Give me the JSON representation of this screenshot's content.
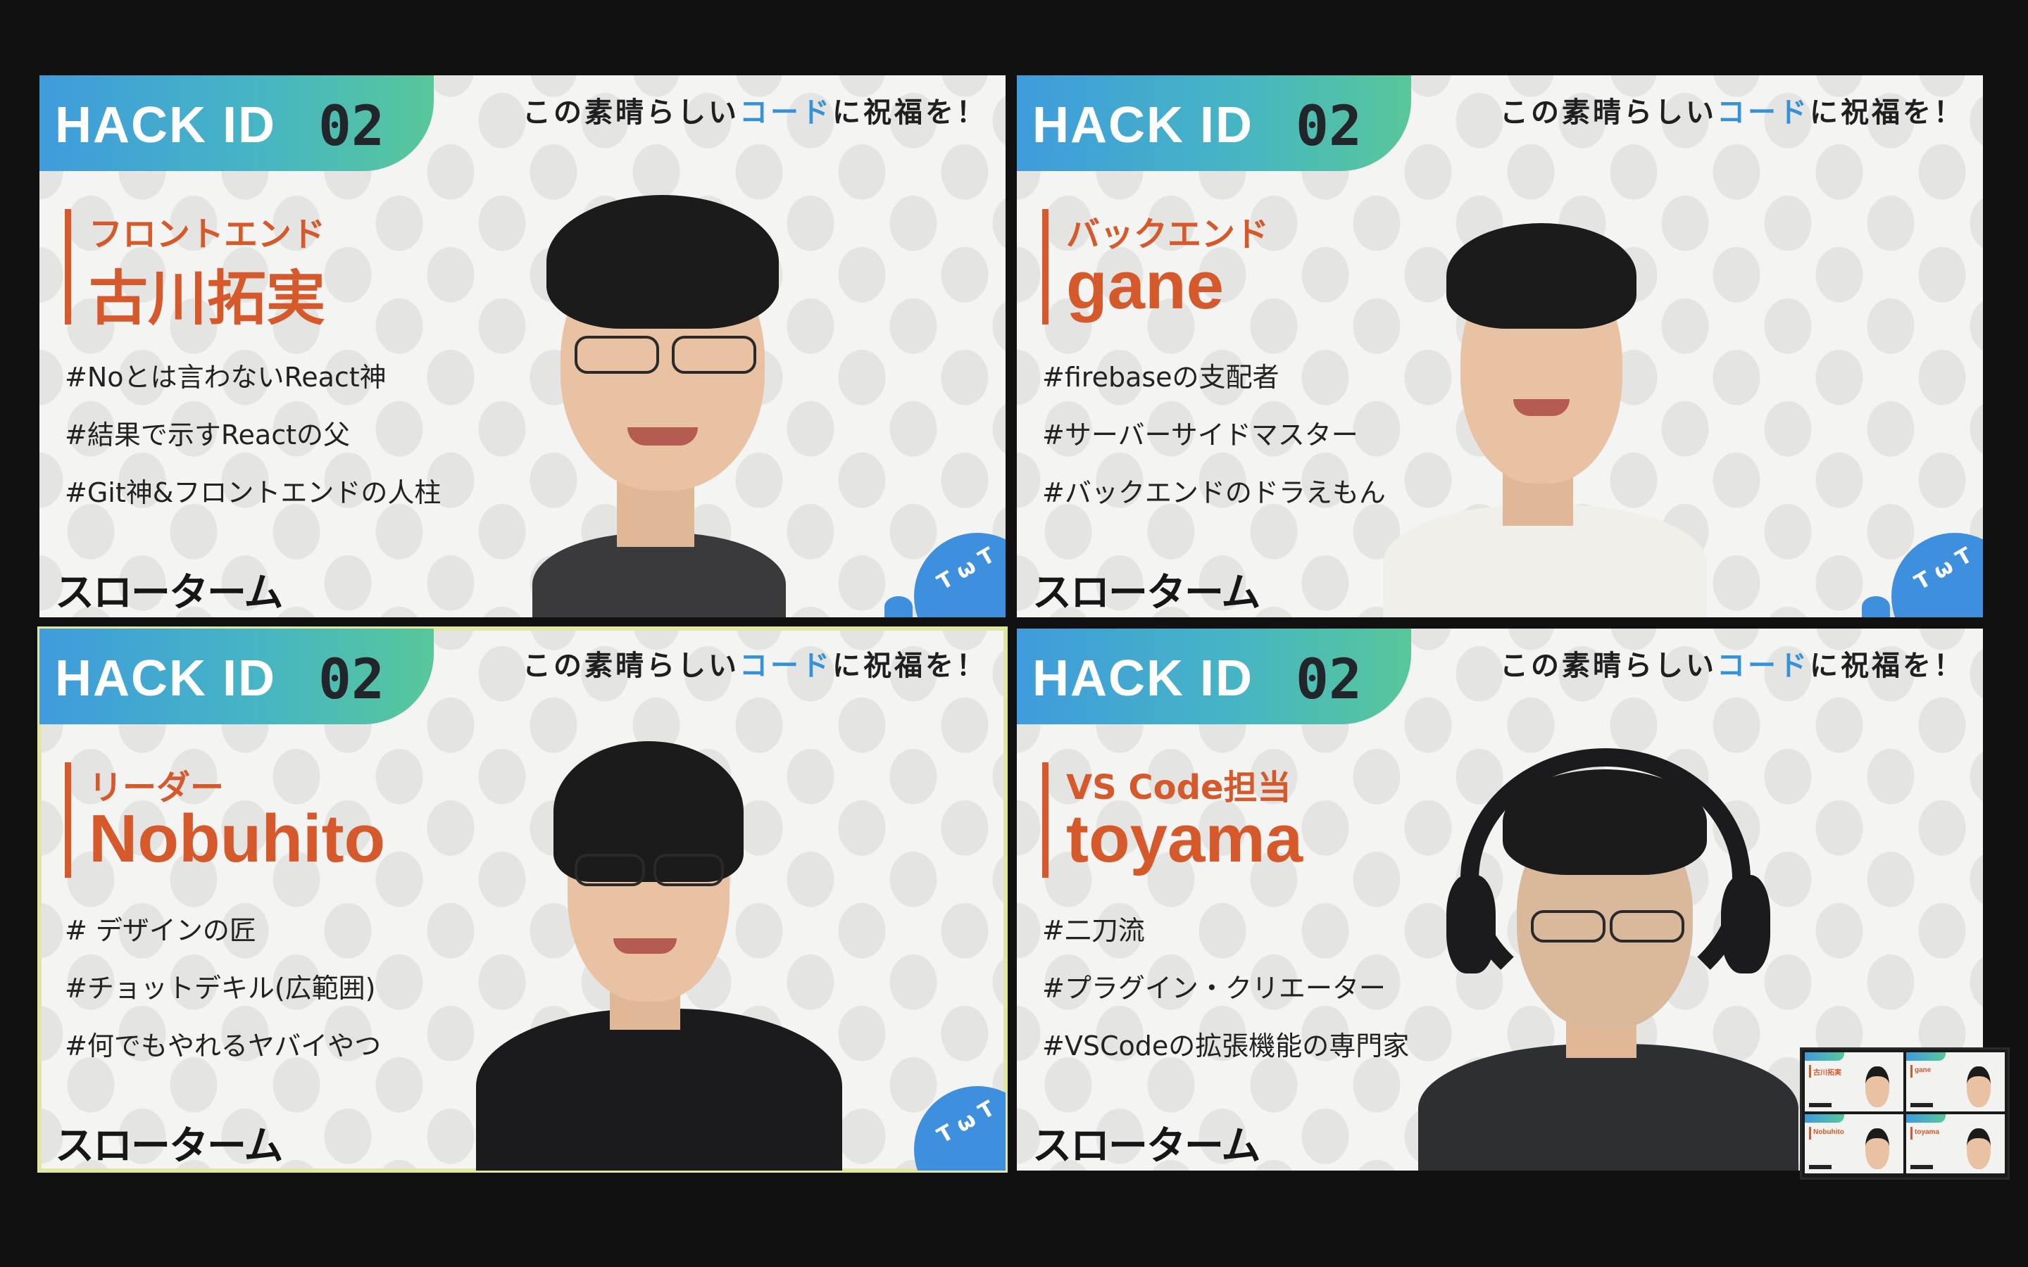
{
  "event": {
    "banner_title": "HACK ID",
    "banner_number": "02",
    "tagline_pre": "この素晴らしい",
    "tagline_highlight": "コード",
    "tagline_post": "に祝福を！",
    "logo_text": "スローターム",
    "badge_text": "T ω T"
  },
  "participants": [
    {
      "role": "フロントエンド",
      "name": "古川拓実",
      "tags": [
        "#Noとは言わないReact神",
        "#結果で示すReactの父",
        "#Git神&フロントエンドの人柱"
      ]
    },
    {
      "role": "バックエンド",
      "name": "gane",
      "tags": [
        "#firebaseの支配者",
        "#サーバーサイドマスター",
        "#バックエンドのドラえもん"
      ]
    },
    {
      "role": "リーダー",
      "name": "Nobuhito",
      "tags": [
        "# デザインの匠",
        "#チョットデキル(広範囲)",
        "#何でもやれるヤバイやつ"
      ]
    },
    {
      "role": "VS Code担当",
      "name": "toyama",
      "tags": [
        "#二刀流",
        "#プラグイン・クリエーター",
        "#VSCodeの拡張機能の専門家"
      ]
    }
  ],
  "colors": {
    "accent_orange": "#d6592b",
    "accent_blue": "#3591d8",
    "active_speaker_border": "#e3e6a0"
  },
  "self_view": {
    "label": "self-view-thumbnail"
  }
}
